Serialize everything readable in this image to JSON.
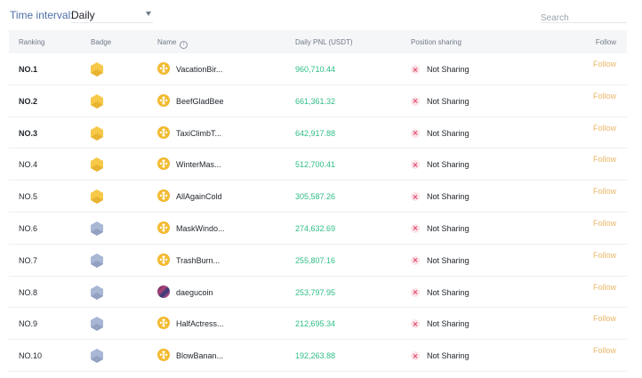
{
  "filters": {
    "time_interval_label": "Time interval:",
    "time_interval_value": "Daily",
    "search_placeholder": "Search"
  },
  "columns": {
    "ranking": "Ranking",
    "badge": "Badge",
    "name": "Name",
    "daily_pnl": "Daily PNL (USDT)",
    "position_sharing": "Position sharing",
    "follow": "Follow"
  },
  "colors": {
    "pnl_positive": "#2ebd85",
    "follow_link": "#e8a94e",
    "badge_gold": "#f3ba2f",
    "badge_silver": "#9aa8c6",
    "not_sharing_icon": "#e04a6a"
  },
  "rows": [
    {
      "rank": "NO.1",
      "badge": "gold",
      "avatar": "bnb-logo-icon",
      "name": "VacationBir...",
      "pnl": "960,710.44",
      "sharing": "Not Sharing",
      "follow": "Follow"
    },
    {
      "rank": "NO.2",
      "badge": "gold",
      "avatar": "bnb-logo-icon",
      "name": "BeefGladBee",
      "pnl": "661,361.32",
      "sharing": "Not Sharing",
      "follow": "Follow"
    },
    {
      "rank": "NO.3",
      "badge": "gold",
      "avatar": "bnb-logo-icon",
      "name": "TaxiClimbT...",
      "pnl": "642,917.88",
      "sharing": "Not Sharing",
      "follow": "Follow"
    },
    {
      "rank": "NO.4",
      "badge": "gold",
      "avatar": "bnb-logo-icon",
      "name": "WinterMas...",
      "pnl": "512,700.41",
      "sharing": "Not Sharing",
      "follow": "Follow"
    },
    {
      "rank": "NO.5",
      "badge": "gold",
      "avatar": "bnb-logo-icon",
      "name": "AllAgainCold",
      "pnl": "305,587.26",
      "sharing": "Not Sharing",
      "follow": "Follow"
    },
    {
      "rank": "NO.6",
      "badge": "silver",
      "avatar": "bnb-logo-icon",
      "name": "MaskWindo...",
      "pnl": "274,632.69",
      "sharing": "Not Sharing",
      "follow": "Follow"
    },
    {
      "rank": "NO.7",
      "badge": "silver",
      "avatar": "bnb-logo-icon",
      "name": "TrashBurn...",
      "pnl": "255,807.16",
      "sharing": "Not Sharing",
      "follow": "Follow"
    },
    {
      "rank": "NO.8",
      "badge": "silver",
      "avatar": "user-photo-avatar",
      "name": "daegucoin",
      "pnl": "253,797.95",
      "sharing": "Not Sharing",
      "follow": "Follow"
    },
    {
      "rank": "NO.9",
      "badge": "silver",
      "avatar": "bnb-logo-icon",
      "name": "HalfActress...",
      "pnl": "212,695.34",
      "sharing": "Not Sharing",
      "follow": "Follow"
    },
    {
      "rank": "NO.10",
      "badge": "silver",
      "avatar": "bnb-logo-icon",
      "name": "BlowBanan...",
      "pnl": "192,263.88",
      "sharing": "Not Sharing",
      "follow": "Follow"
    }
  ]
}
